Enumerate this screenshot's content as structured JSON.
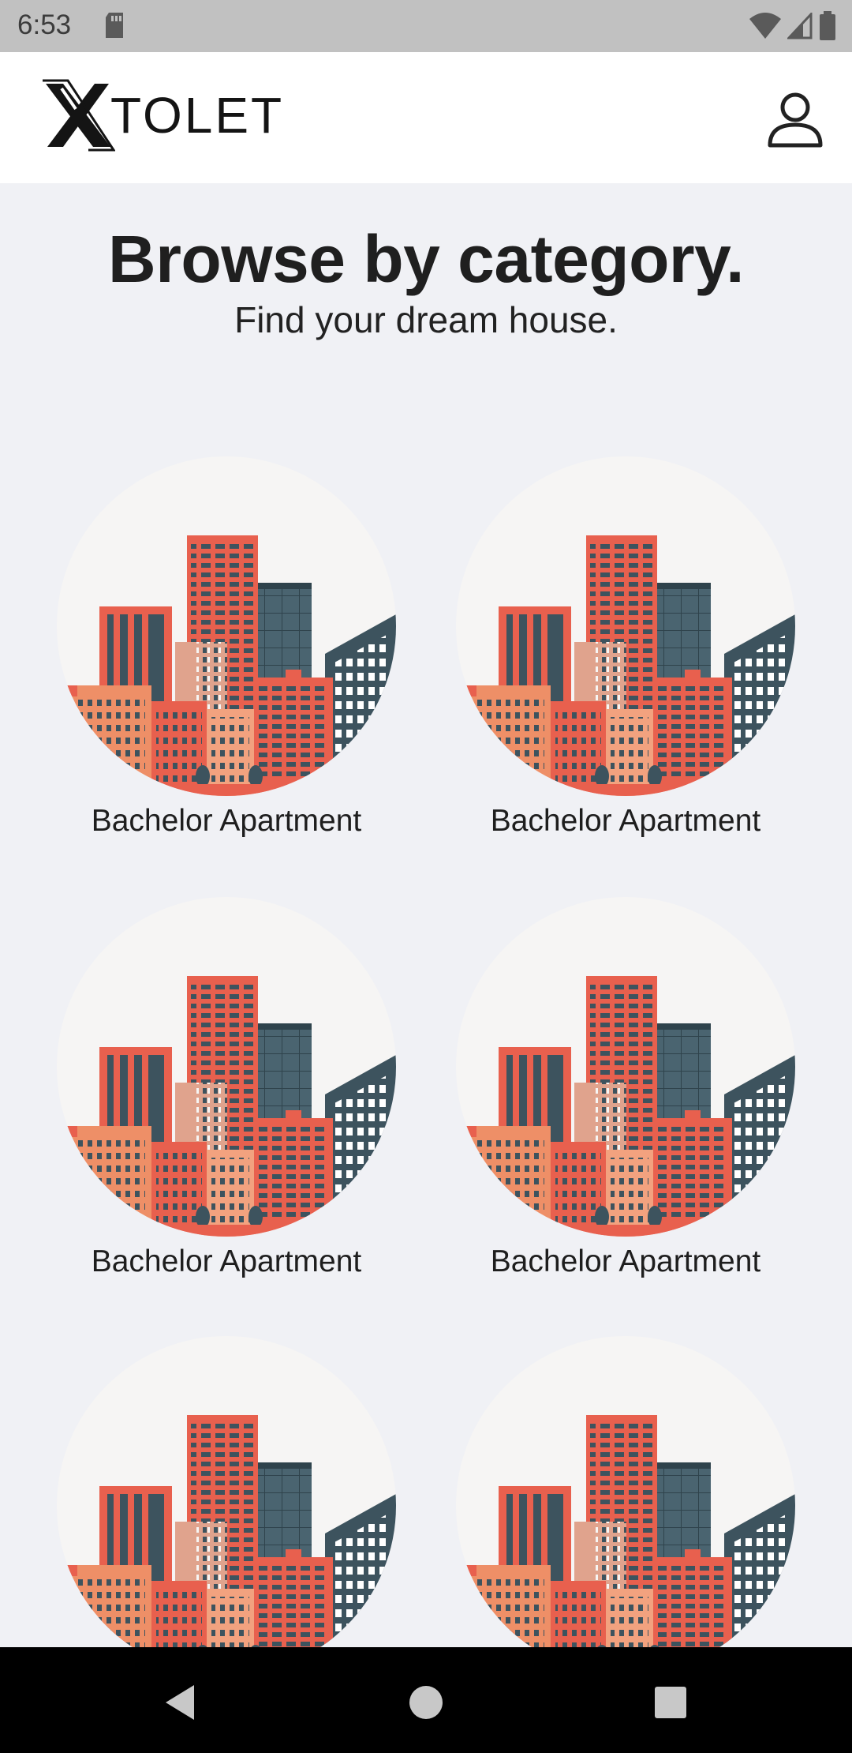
{
  "status_bar": {
    "time": "6:53"
  },
  "header": {
    "logo_text": "TOLET",
    "profile_icon": "person-outline-icon"
  },
  "heading": {
    "title": "Browse by category.",
    "subtitle": "Find your dream house."
  },
  "categories": [
    {
      "label": "Bachelor Apartment"
    },
    {
      "label": "Bachelor Apartment"
    },
    {
      "label": "Bachelor Apartment"
    },
    {
      "label": "Bachelor Apartment"
    },
    {
      "label": ""
    },
    {
      "label": ""
    }
  ],
  "nav": {
    "back": "back-icon",
    "home": "home-icon",
    "recents": "recents-icon"
  },
  "colors": {
    "accent_red": "#e8604e",
    "dark_slate": "#3d535e",
    "peach": "#ee8f67"
  }
}
